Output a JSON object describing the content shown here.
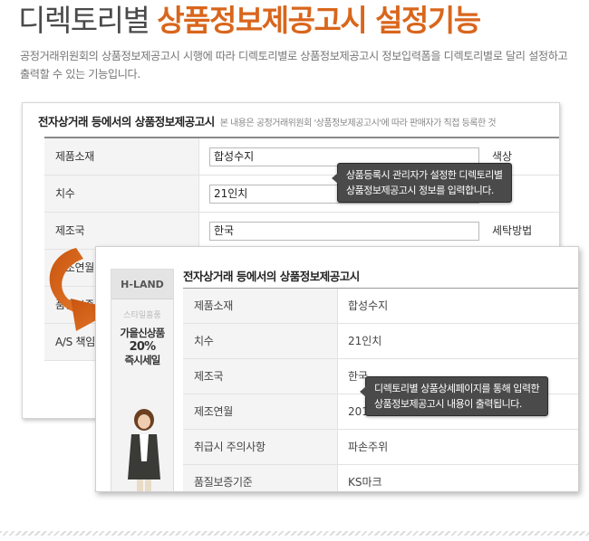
{
  "headline": {
    "normal": "디렉토리별 ",
    "accent": "상품정보제공고시 설정기능"
  },
  "description": "공정거래위원회의 상품정보제공고시 시행에 따라 디렉토리별로 상품정보제공고시 정보입력폼을 디렉토리별로 달리 설정하고 출력할 수 있는 기능입니다.",
  "back_panel": {
    "title": "전자상거래 등에서의 상품정보제공고시",
    "note": "본 내용은 공정거래위원회 '상품정보제공고시'에 따라 판매자가 직접 등록한 것",
    "rows": [
      {
        "label": "제품소재",
        "value": "합성수지",
        "side": "색상"
      },
      {
        "label": "치수",
        "value": "21인치",
        "side": ""
      },
      {
        "label": "제조국",
        "value": "한국",
        "side": "세탁방법"
      },
      {
        "label": "제조연월",
        "value": "",
        "side": ""
      },
      {
        "label": "품질보증",
        "value": "",
        "side": ""
      },
      {
        "label": "A/S 책임",
        "value": "",
        "side": ""
      }
    ]
  },
  "front_panel": {
    "title": "전자상거래 등에서의 상품정보제공고시",
    "banner": {
      "brand": "H-LAND",
      "sub": "스타일홈품",
      "promo_line1": "가을신상품",
      "promo_line2": "20%",
      "promo_line3": "즉시세일"
    },
    "rows": [
      {
        "label": "제품소재",
        "value": "합성수지"
      },
      {
        "label": "치수",
        "value": "21인치"
      },
      {
        "label": "제조국",
        "value": "한국"
      },
      {
        "label": "제조연월",
        "value": "201"
      },
      {
        "label": "취급시 주의사항",
        "value": "파손주위"
      },
      {
        "label": "품질보증기준",
        "value": "KS마크"
      }
    ]
  },
  "tooltips": {
    "input": "상품등록시 관리자가 설정한 디렉토리별\n상품정보제공고시 정보를 입력합니다.",
    "output": "디렉토리별 상품상세페이지를 통해 입력한\n상품정보제공고시 내용이 출력됩니다."
  },
  "colors": {
    "accent": "#d9661c",
    "tooltip_bg": "#4a4a4a",
    "label_bg": "#f4f4f4"
  }
}
